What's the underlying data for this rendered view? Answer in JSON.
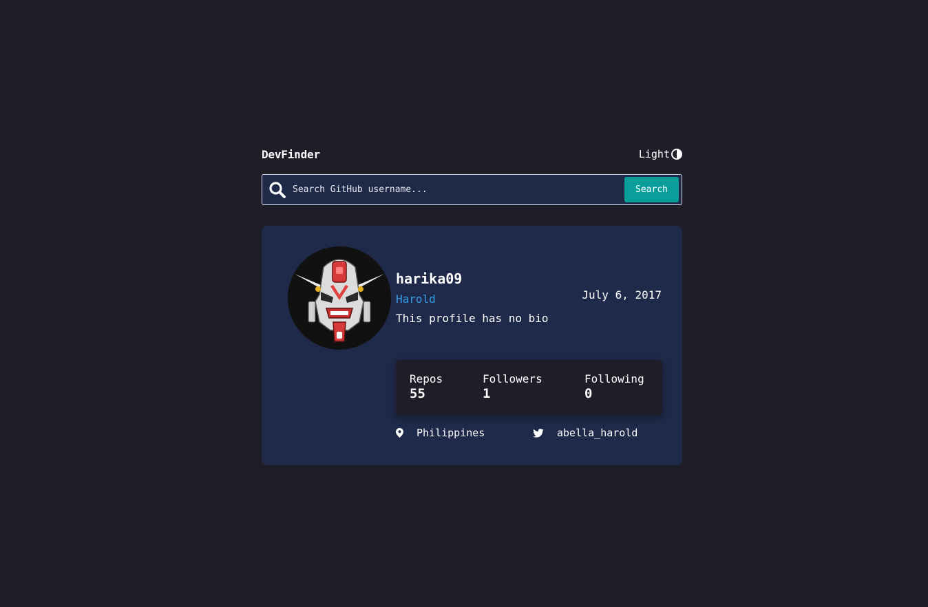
{
  "header": {
    "brand": "DevFinder",
    "theme_toggle_label": "Light"
  },
  "search": {
    "placeholder": "Search GitHub username...",
    "value": "",
    "button_label": "Search"
  },
  "profile": {
    "username": "harika09",
    "name": "Harold",
    "bio": "This profile has no bio",
    "joined": "July 6, 2017"
  },
  "stats": {
    "repos_label": "Repos",
    "repos_value": "55",
    "followers_label": "Followers",
    "followers_value": "1",
    "following_label": "Following",
    "following_value": "0"
  },
  "links": {
    "location": "Philippines",
    "twitter": "abella_harold"
  },
  "colors": {
    "background": "#1e1d28",
    "card": "#1f2a4a",
    "accent": "#0a9e9a",
    "link": "#3a9ce8"
  },
  "icons": {
    "theme": "half-circle-icon",
    "search": "search-icon",
    "location": "map-pin-icon",
    "twitter": "twitter-icon"
  }
}
